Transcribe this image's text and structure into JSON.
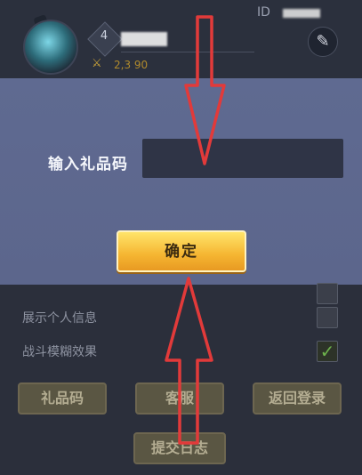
{
  "profile": {
    "level": "4",
    "gold": "2,3 90",
    "id_label": "ID"
  },
  "gift_dialog": {
    "code_label": "输入礼品码",
    "code_value": "",
    "confirm_label": "确定"
  },
  "settings": {
    "items": [
      {
        "label": "展示个人信息",
        "checked": false
      },
      {
        "label": "战斗模糊效果",
        "checked": true
      }
    ]
  },
  "buttons": {
    "gift_code": "礼品码",
    "customer_service": "客服",
    "back_login": "返回登录",
    "submit_log": "提交日志"
  },
  "annotation": {
    "arrow_color": "#e23a3a"
  },
  "icons": {
    "brush": "brush-icon",
    "gold": "gold-icon",
    "check": "check-icon"
  }
}
